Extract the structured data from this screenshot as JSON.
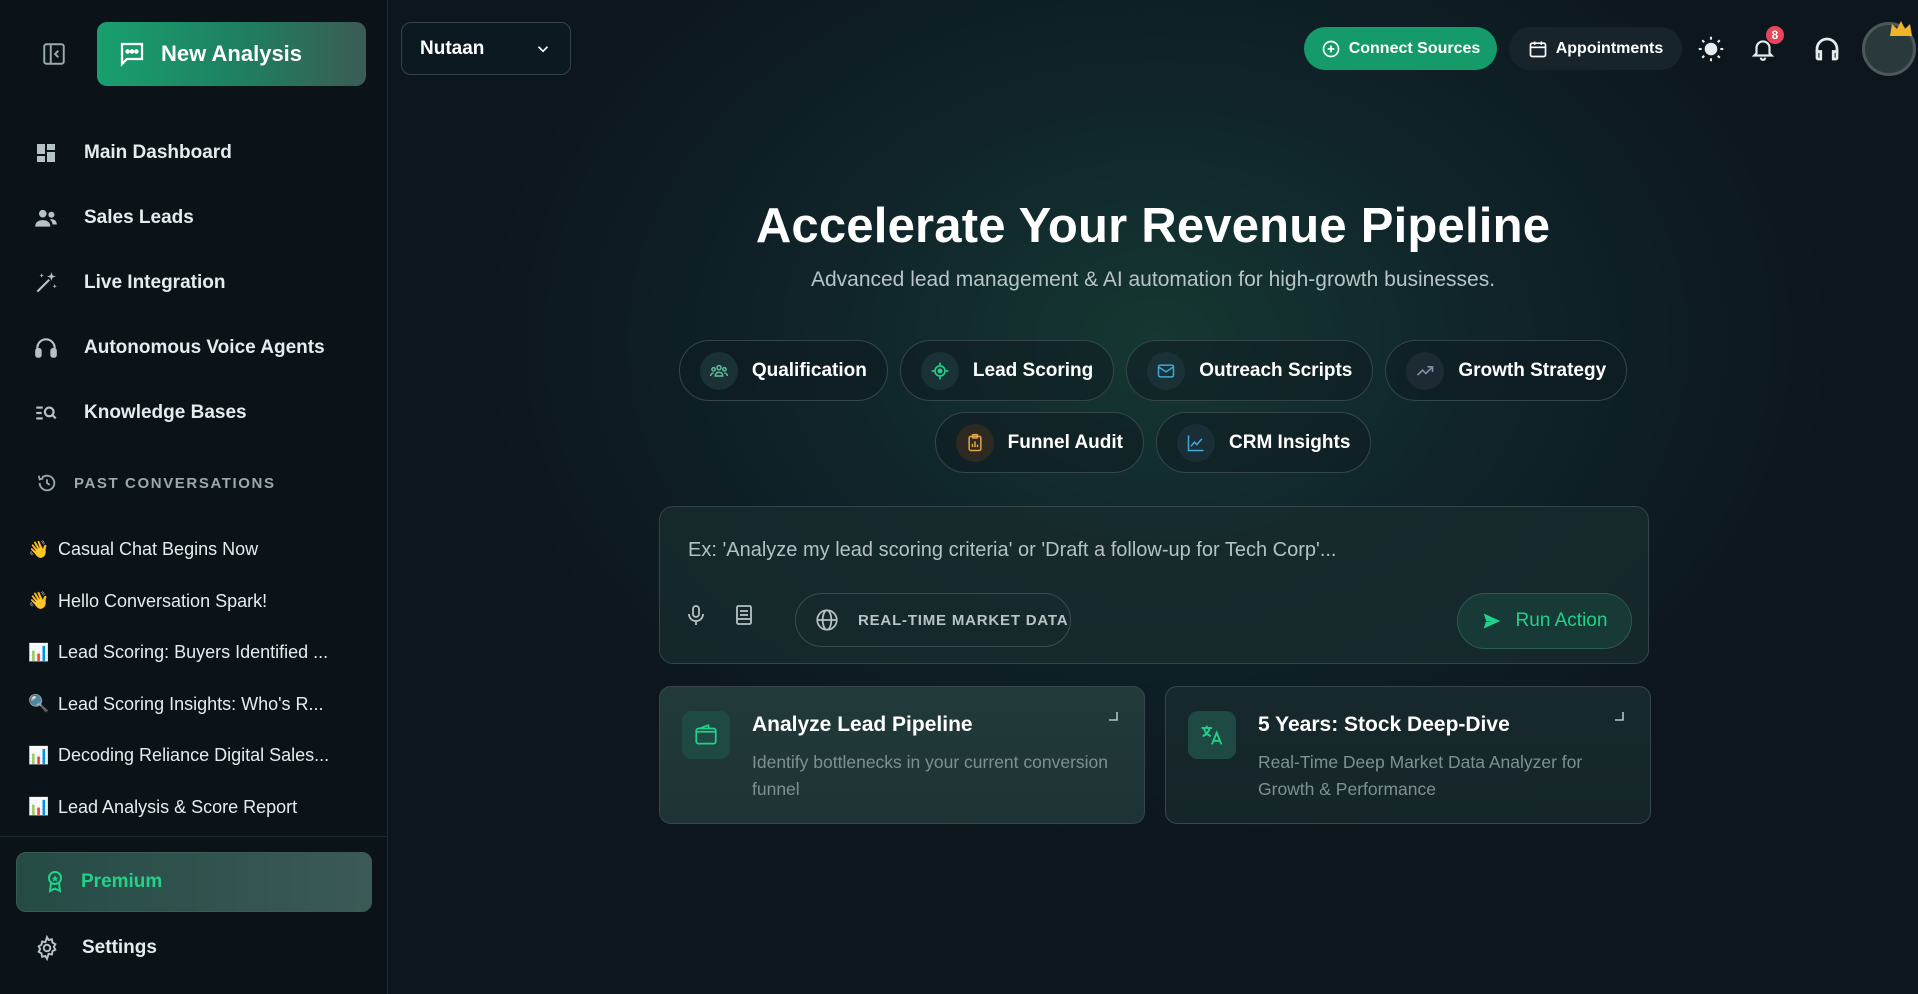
{
  "sidebar": {
    "new_analysis_label": "New Analysis",
    "nav": [
      {
        "label": "Main Dashboard",
        "icon": "dashboard-icon"
      },
      {
        "label": "Sales Leads",
        "icon": "users-icon"
      },
      {
        "label": "Live Integration",
        "icon": "magic-wand-icon"
      },
      {
        "label": "Autonomous Voice Agents",
        "icon": "headset-icon"
      },
      {
        "label": "Knowledge Bases",
        "icon": "search-list-icon"
      }
    ],
    "past_header": "PAST CONVERSATIONS",
    "conversations": [
      {
        "emoji": "👋",
        "title": "Casual Chat Begins Now"
      },
      {
        "emoji": "👋",
        "title": "Hello Conversation Spark!"
      },
      {
        "emoji": "📊",
        "title": "Lead Scoring: Buyers Identified ..."
      },
      {
        "emoji": "🔍",
        "title": "Lead Scoring Insights: Who's R..."
      },
      {
        "emoji": "📊",
        "title": "Decoding Reliance Digital Sales..."
      },
      {
        "emoji": "📊",
        "title": "Lead Analysis & Score Report"
      }
    ],
    "premium_label": "Premium",
    "settings_label": "Settings"
  },
  "header": {
    "workspace": "Nutaan",
    "connect_label": "Connect Sources",
    "appointments_label": "Appointments",
    "notification_count": "8"
  },
  "hero": {
    "title": "Accelerate Your Revenue Pipeline",
    "subtitle": "Advanced lead management & AI automation for high-growth businesses."
  },
  "chips": [
    {
      "label": "Qualification",
      "icon": "team-icon"
    },
    {
      "label": "Lead Scoring",
      "icon": "target-icon"
    },
    {
      "label": "Outreach Scripts",
      "icon": "mail-icon"
    },
    {
      "label": "Growth Strategy",
      "icon": "trend-up-icon"
    },
    {
      "label": "Funnel Audit",
      "icon": "clipboard-chart-icon"
    },
    {
      "label": "CRM Insights",
      "icon": "line-chart-icon"
    }
  ],
  "composer": {
    "placeholder": "Ex: 'Analyze my lead scoring criteria' or 'Draft a follow-up for Tech Corp'...",
    "value": "",
    "market_label": "REAL-TIME MARKET DATA",
    "run_label": "Run Action"
  },
  "cards": [
    {
      "title": "Analyze Lead Pipeline",
      "desc": "Identify bottlenecks in your current conversion funnel"
    },
    {
      "title": "5 Years: Stock Deep-Dive",
      "desc": "Real-Time Deep Market Data Analyzer for Growth & Performance"
    }
  ],
  "colors": {
    "accent": "#22d18a",
    "primary_button": "#159b6a",
    "badge": "#e8455a"
  }
}
